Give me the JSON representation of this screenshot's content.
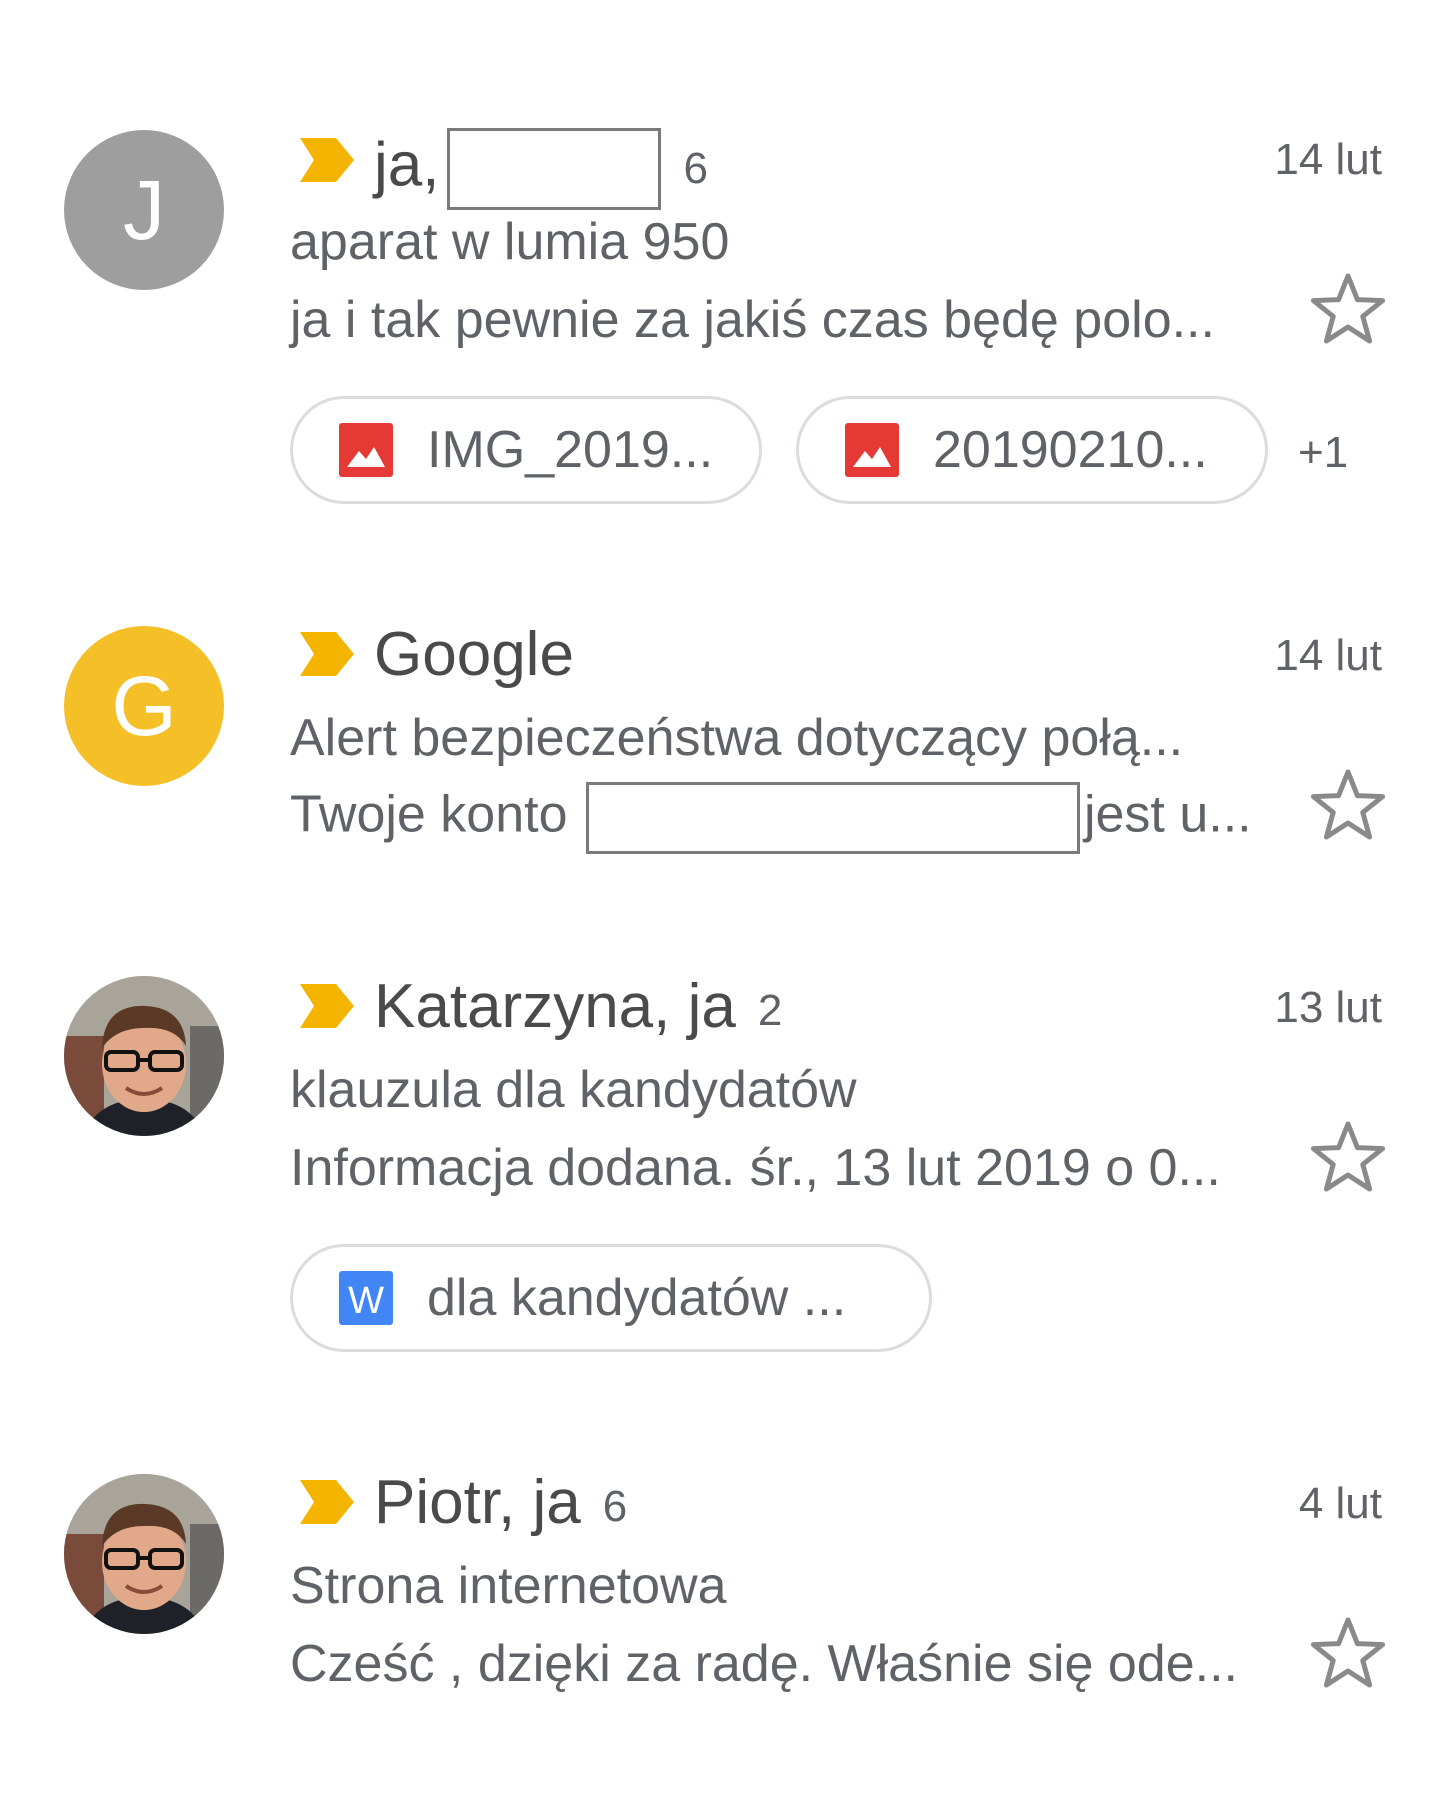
{
  "emails": [
    {
      "avatar_letter": "J",
      "avatar_color": "#9e9e9e",
      "sender": "ja,",
      "count": "6",
      "date": "14 lut",
      "subject": "aparat w lumia 950",
      "snippet": "ja i tak pewnie za jakiś czas będę polo...",
      "attachments": [
        {
          "icon": "image-icon",
          "name": "IMG_2019..."
        },
        {
          "icon": "image-icon",
          "name": "20190210..."
        }
      ],
      "more": "+1"
    },
    {
      "avatar_letter": "G",
      "avatar_color": "#f5bf28",
      "sender": "Google",
      "date": "14 lut",
      "subject": "Alert bezpieczeństwa dotyczący połą...",
      "snippet_before": "Twoje konto",
      "snippet_after": "jest u..."
    },
    {
      "avatar_type": "photo",
      "sender": "Katarzyna, ja",
      "count": "2",
      "date": "13 lut",
      "subject": "klauzula dla kandydatów",
      "snippet": "Informacja dodana. śr., 13 lut 2019 o 0...",
      "attachments": [
        {
          "icon": "word-doc-icon",
          "icon_letter": "W",
          "name": "dla kandydatów ..."
        }
      ]
    },
    {
      "avatar_type": "photo",
      "sender": "Piotr, ja",
      "count": "6",
      "date": "4 lut",
      "subject": "Strona internetowa",
      "snippet": "Cześć , dzięki za radę. Właśnie się ode..."
    }
  ],
  "colors": {
    "importance": "#f4b400",
    "image_icon": "#e53935",
    "word_icon": "#4285f4",
    "star": "#8a8a8a"
  }
}
